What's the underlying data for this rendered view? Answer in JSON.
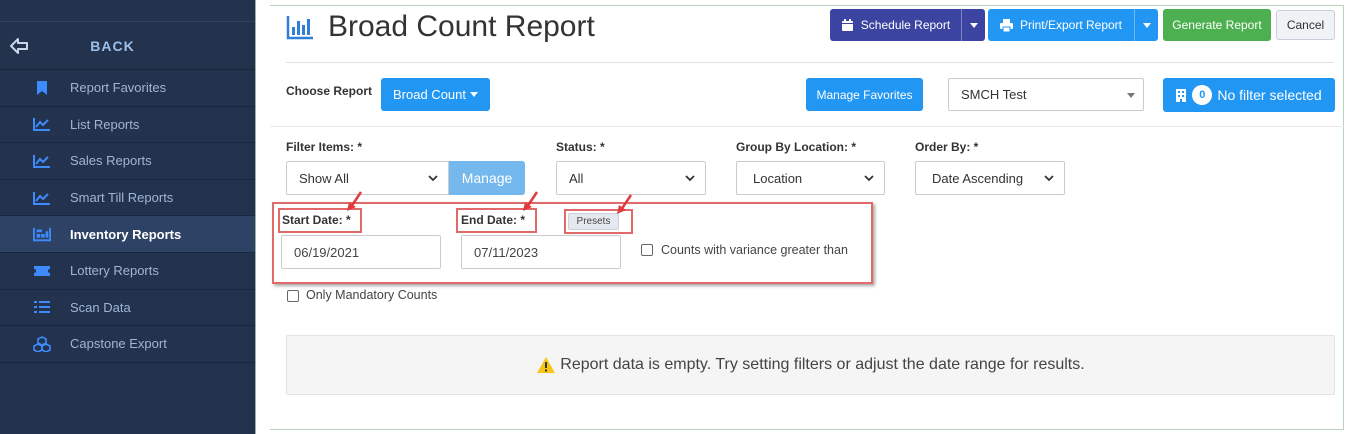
{
  "sidebar": {
    "back_label": "BACK",
    "items": [
      {
        "label": "Report Favorites",
        "icon": "bookmark-icon"
      },
      {
        "label": "List Reports",
        "icon": "line-chart-icon"
      },
      {
        "label": "Sales Reports",
        "icon": "line-chart-icon"
      },
      {
        "label": "Smart Till Reports",
        "icon": "line-chart-icon"
      },
      {
        "label": "Inventory Reports",
        "icon": "inventory-icon"
      },
      {
        "label": "Lottery Reports",
        "icon": "ticket-icon"
      },
      {
        "label": "Scan Data",
        "icon": "list-icon"
      },
      {
        "label": "Capstone Export",
        "icon": "cubes-icon"
      }
    ],
    "active_item": "Inventory Reports"
  },
  "header": {
    "title": "Broad Count Report",
    "schedule_label": "Schedule Report",
    "print_label": "Print/Export Report",
    "generate_label": "Generate Report",
    "cancel_label": "Cancel"
  },
  "choose": {
    "label": "Choose Report",
    "value": "Broad Count",
    "manage_favorites_label": "Manage Favorites",
    "store_value": "SMCH Test",
    "filter_count": "0",
    "filter_label": "No filter selected"
  },
  "filters": {
    "filter_items_label": "Filter Items: *",
    "filter_items_value": "Show All",
    "manage_label": "Manage",
    "status_label": "Status: *",
    "status_value": "All",
    "group_label": "Group By Location: *",
    "group_value": "Location",
    "order_label": "Order By: *",
    "order_value": "Date Ascending",
    "start_label": "Start Date: *",
    "start_value": "06/19/2021",
    "end_label": "End Date: *",
    "end_value": "07/11/2023",
    "presets_label": "Presets",
    "variance_label": "Counts with variance greater than",
    "mandatory_label": "Only Mandatory Counts"
  },
  "alert": {
    "message": "Report data is empty. Try setting filters or adjust the date range for results."
  },
  "colors": {
    "sidebar_bg": "#23324d",
    "primary": "#2196f3",
    "schedule": "#3b44a1",
    "generate": "#4caf50",
    "annotation": "#e06a6a"
  }
}
